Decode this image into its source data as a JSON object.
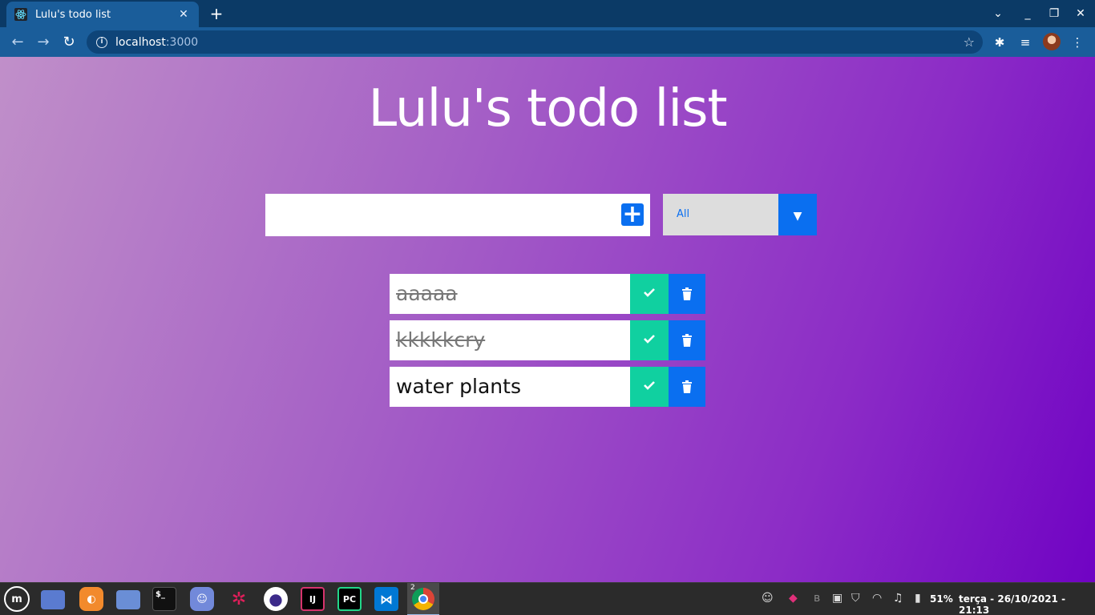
{
  "browser": {
    "tab_title": "Lulu's todo list",
    "tab_close": "✕",
    "new_tab": "+",
    "url_host": "localhost",
    "url_port": ":3000",
    "icons": [
      "react-icon",
      "back-icon",
      "forward-icon",
      "reload-icon",
      "info-icon",
      "star-icon",
      "extensions-icon",
      "media-icon",
      "avatar",
      "menu-icon"
    ]
  },
  "app": {
    "title": "Lulu's todo list",
    "input": {
      "value": "",
      "placeholder": ""
    },
    "add_button": "+",
    "filter": {
      "selected": "All",
      "arrow": "▼"
    },
    "todos": [
      {
        "text": "aaaaa",
        "completed": true
      },
      {
        "text": "kkkkkcry",
        "completed": true
      },
      {
        "text": "water plants",
        "completed": false
      }
    ],
    "colors": {
      "accent": "#0a6ff0",
      "check": "#10d0a0",
      "gradient_start": "#c08fc9",
      "gradient_end": "#7003c4"
    }
  },
  "taskbar": {
    "battery": "51%",
    "datetime": "terça - 26/10/2021 - 21:13",
    "chrome_badge": "2",
    "apps": [
      "mint-menu",
      "desktop",
      "firefox",
      "files",
      "terminal",
      "discord",
      "slack",
      "eclipse",
      "intellij",
      "pycharm",
      "vscode",
      "chrome"
    ]
  }
}
